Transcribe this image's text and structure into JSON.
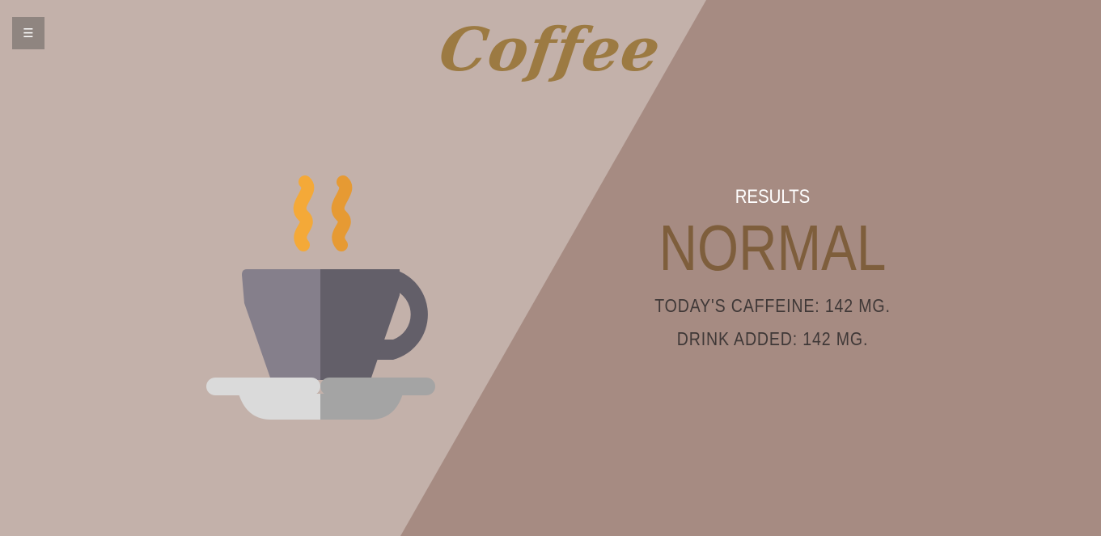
{
  "header": {
    "title": "Coffee",
    "menu_icon": "hamburger-menu-icon"
  },
  "illustration": {
    "icon": "coffee-cup-icon"
  },
  "results": {
    "label": "RESULTS",
    "status": "NORMAL",
    "todays_caffeine": "TODAY'S CAFFEINE: 142 MG.",
    "drink_added": "DRINK ADDED: 142 MG."
  },
  "colors": {
    "background_left": "#c3b1aa",
    "background_right": "#a68b82",
    "title": "#9c7a42",
    "status": "#7e5e3c",
    "menu_button": "#8f8580"
  }
}
